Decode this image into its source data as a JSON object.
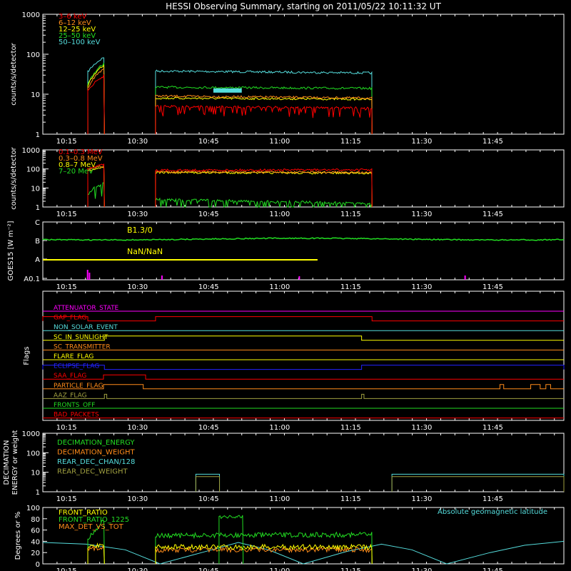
{
  "title": "HESSI Observing Summary, starting on 2011/05/22 10:11:32 UT",
  "time_ticks": [
    "10:15",
    "10:30",
    "10:45",
    "11:00",
    "11:15",
    "11:30",
    "11:45"
  ],
  "xrange_minutes": [
    10.0,
    120.0
  ],
  "colors": {
    "red": "#ff0000",
    "orange": "#ff8c1a",
    "yellow": "#ffff00",
    "green": "#22dd22",
    "cyan": "#55dddd",
    "magenta": "#ff00ff",
    "blue": "#2222ff",
    "olive": "#a0a040",
    "axis": "#ffffff"
  },
  "chart_data": [
    {
      "id": "lowenergy",
      "type": "line",
      "ylabel": "counts/s/detector",
      "yscale": "log",
      "ylim": [
        1,
        1000
      ],
      "yticks": [
        "1",
        "10",
        "100",
        "1000"
      ],
      "series": [
        {
          "name": "3–6 keV",
          "color": "red",
          "segments": [
            {
              "start": 19.5,
              "end": 23.0,
              "from": 12,
              "to": 30
            },
            {
              "start": 33.8,
              "end": 79.5,
              "from": 5,
              "to": 4.5
            }
          ]
        },
        {
          "name": "6–12 keV",
          "color": "orange",
          "segments": [
            {
              "start": 19.5,
              "end": 23.0,
              "from": 14,
              "to": 45
            },
            {
              "start": 33.8,
              "end": 79.5,
              "from": 9,
              "to": 8
            }
          ]
        },
        {
          "name": "12–25 keV",
          "color": "yellow",
          "segments": [
            {
              "start": 19.5,
              "end": 23.0,
              "from": 16,
              "to": 55
            },
            {
              "start": 33.8,
              "end": 79.5,
              "from": 8,
              "to": 7.5
            }
          ]
        },
        {
          "name": "25–50 keV",
          "color": "green",
          "segments": [
            {
              "start": 19.5,
              "end": 23.0,
              "from": 17,
              "to": 60
            },
            {
              "start": 33.8,
              "end": 79.5,
              "from": 15,
              "to": 14
            }
          ]
        },
        {
          "name": "50–100 keV",
          "color": "cyan",
          "segments": [
            {
              "start": 19.5,
              "end": 23.0,
              "from": 36,
              "to": 85
            },
            {
              "start": 33.8,
              "end": 79.5,
              "from": 38,
              "to": 34
            }
          ]
        }
      ]
    },
    {
      "id": "highenergy",
      "type": "line",
      "ylabel": "counts/s/detector",
      "yscale": "log",
      "ylim": [
        1,
        1000
      ],
      "yticks": [
        "1",
        "10",
        "100",
        "1000"
      ],
      "series": [
        {
          "name": "0.1–0.3 MeV",
          "color": "red",
          "segments": [
            {
              "start": 19.5,
              "end": 23.0,
              "from": 100,
              "to": 190
            },
            {
              "start": 33.8,
              "end": 79.5,
              "from": 85,
              "to": 90
            }
          ]
        },
        {
          "name": "0.3–0.8 MeV",
          "color": "orange",
          "segments": [
            {
              "start": 19.5,
              "end": 23.0,
              "from": 90,
              "to": 150
            },
            {
              "start": 33.8,
              "end": 79.5,
              "from": 70,
              "to": 65
            }
          ]
        },
        {
          "name": "0.8–7 MeV",
          "color": "yellow",
          "segments": [
            {
              "start": 19.5,
              "end": 23.0,
              "from": 80,
              "to": 130
            },
            {
              "start": 33.8,
              "end": 79.5,
              "from": 65,
              "to": 60
            }
          ]
        },
        {
          "name": "7–20 MeV",
          "color": "green",
          "segments": [
            {
              "start": 19.5,
              "end": 23.0,
              "from": 4,
              "to": 20
            },
            {
              "start": 33.8,
              "end": 79.5,
              "from": 2.5,
              "to": 1.5
            }
          ]
        }
      ]
    },
    {
      "id": "goes",
      "type": "line",
      "ylabel": "GOES15 [W m⁻²]",
      "yscale": "log",
      "yticks": [
        "A0.1",
        "A",
        "B",
        "C"
      ],
      "annotations": [
        "B1.3/0",
        "NaN/NaN"
      ],
      "series": [
        {
          "name": "GOES long",
          "color": "green",
          "level": "B1.3"
        },
        {
          "name": "GOES short",
          "color": "yellow",
          "level": "A (flat, to ~11:08)"
        }
      ]
    },
    {
      "id": "flags",
      "type": "line",
      "ylabel": "Flags",
      "series": [
        {
          "name": "ATTENUATOR_STATE",
          "color": "magenta",
          "high": []
        },
        {
          "name": "GAP_FLAG",
          "color": "red",
          "high": [
            [
              10,
              19.5
            ],
            [
              33.8,
              79.5
            ]
          ]
        },
        {
          "name": "NON_SOLAR_EVENT",
          "color": "cyan",
          "high": []
        },
        {
          "name": "SC_IN_SUNLIGHT",
          "color": "yellow",
          "high": [
            [
              23.0,
              77.3
            ]
          ]
        },
        {
          "name": "SC_TRANSMITTER",
          "color": "orange",
          "high": []
        },
        {
          "name": "FLARE_FLAG",
          "color": "yellow",
          "high": []
        },
        {
          "name": "ECLIPSE_FLAG",
          "color": "blue",
          "high": [
            [
              10,
              23.0
            ],
            [
              77.3,
              120
            ]
          ]
        },
        {
          "name": "SAA_FLAG",
          "color": "red",
          "high": [
            [
              22.8,
              31.7
            ]
          ]
        },
        {
          "name": "PARTICLE_FLAG",
          "color": "orange",
          "high": [
            [
              22.8,
              31.2
            ],
            [
              106.5,
              107.3
            ],
            [
              113.0,
              115.0
            ],
            [
              116.2,
              117.2
            ]
          ]
        },
        {
          "name": "AAZ_FLAG",
          "color": "olive",
          "high": [
            [
              23.0,
              23.5
            ],
            [
              77.3,
              77.8
            ]
          ]
        },
        {
          "name": "FRONTS_OFF",
          "color": "green",
          "high": []
        },
        {
          "name": "BAD_PACKETS",
          "color": "red",
          "high": []
        }
      ]
    },
    {
      "id": "decimation",
      "type": "line",
      "ylabel": "DECIMATION ENERGY or weight",
      "yscale": "log",
      "ylim": [
        1,
        1000
      ],
      "yticks": [
        "1",
        "10",
        "100",
        "1000"
      ],
      "series": [
        {
          "name": "DECIMATION_ENERGY",
          "color": "green",
          "segments": []
        },
        {
          "name": "DECIMATION_WEIGHT",
          "color": "orange",
          "segments": []
        },
        {
          "name": "REAR_DEC_CHAN/128",
          "color": "cyan",
          "segments": [
            {
              "start": 42.3,
              "end": 47.3,
              "value": 8
            },
            {
              "start": 83.7,
              "end": 120,
              "value": 8
            }
          ]
        },
        {
          "name": "REAR_DEC_WEIGHT",
          "color": "olive",
          "segments": [
            {
              "start": 42.3,
              "end": 47.3,
              "value": 6
            },
            {
              "start": 83.7,
              "end": 120,
              "value": 6
            }
          ]
        }
      ]
    },
    {
      "id": "ratios",
      "type": "line",
      "ylabel": "Degrees or %",
      "ylim": [
        0,
        100
      ],
      "yticks": [
        "0",
        "20",
        "40",
        "60",
        "80",
        "100"
      ],
      "series": [
        {
          "name": "FRONT_RATIO",
          "color": "yellow",
          "segments": [
            {
              "start": 19.5,
              "end": 23.0,
              "from": 30,
              "to": 35
            },
            {
              "start": 33.8,
              "end": 79.5,
              "from": 30,
              "to": 30
            }
          ]
        },
        {
          "name": "FRONT_RATIO_1225",
          "color": "green",
          "segments": [
            {
              "start": 19.5,
              "end": 23.0,
              "from": 45,
              "to": 78
            },
            {
              "start": 33.8,
              "end": 79.5,
              "from": 50,
              "to": 52
            }
          ]
        },
        {
          "name": "MAX_DET_VS_TOT",
          "color": "orange",
          "segments": [
            {
              "start": 19.5,
              "end": 23.0,
              "from": 25,
              "to": 30
            },
            {
              "start": 33.8,
              "end": 79.5,
              "from": 25,
              "to": 25
            }
          ]
        },
        {
          "name": "Absolute geomagnetic latitude",
          "color": "cyan",
          "points": [
            [
              0,
              38
            ],
            [
              10,
              35
            ],
            [
              19,
              25
            ],
            [
              27,
              0
            ],
            [
              38,
              23
            ],
            [
              45,
              38
            ],
            [
              52,
              25
            ],
            [
              60,
              0
            ],
            [
              70,
              22
            ],
            [
              78,
              35
            ],
            [
              85,
              25
            ],
            [
              93,
              0
            ],
            [
              103,
              20
            ],
            [
              111,
              33
            ],
            [
              120,
              40
            ]
          ]
        }
      ]
    }
  ]
}
